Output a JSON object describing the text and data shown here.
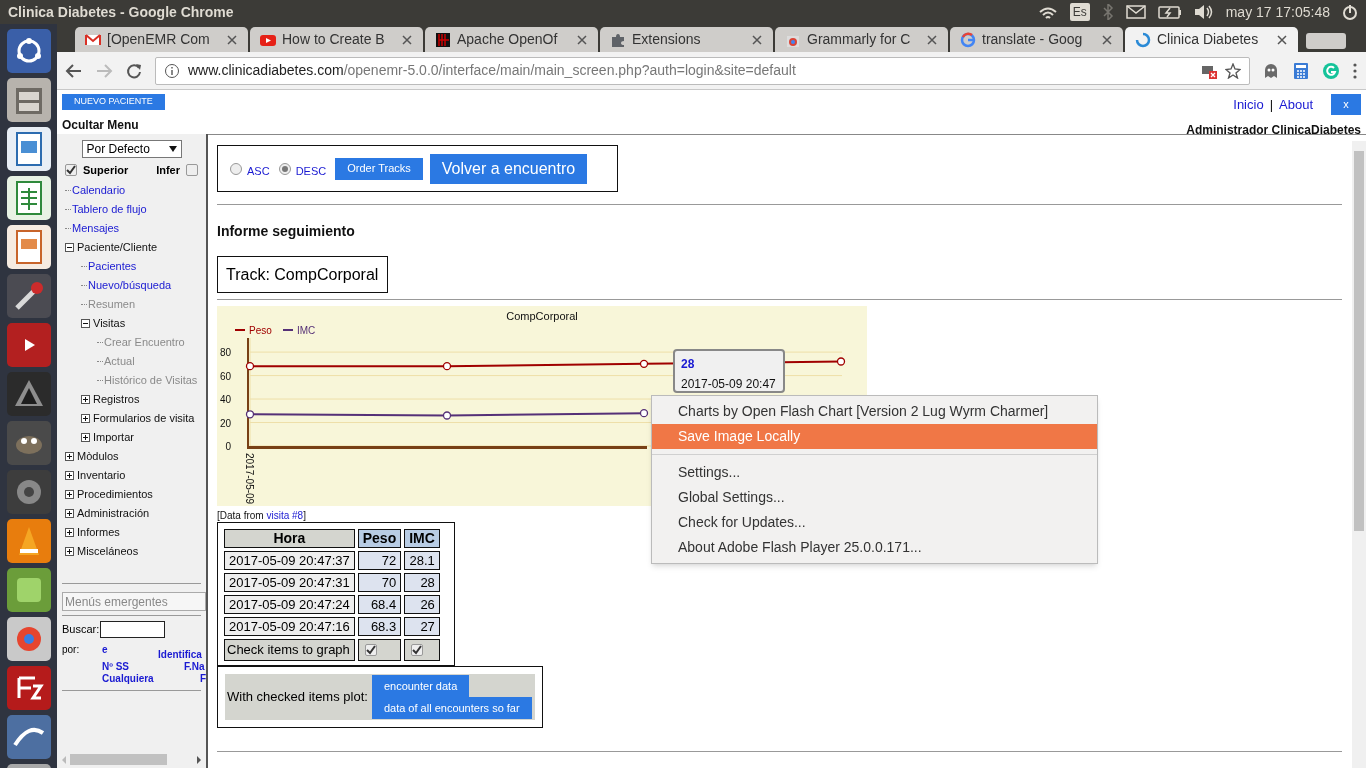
{
  "top_panel": {
    "title": "Clinica Diabetes - Google Chrome",
    "keyboard_layout": "Es",
    "clock": "may 17 17:05:48"
  },
  "browser": {
    "tabs": [
      {
        "title": "[OpenEMR Com",
        "kind": "gmail",
        "selected": false
      },
      {
        "title": "How to Create B",
        "kind": "youtube",
        "selected": false
      },
      {
        "title": "Apache OpenOf",
        "kind": "openoffice",
        "selected": false
      },
      {
        "title": "Extensions",
        "kind": "puzzle",
        "selected": false
      },
      {
        "title": "Grammarly for C",
        "kind": "store",
        "selected": false
      },
      {
        "title": "translate - Goog",
        "kind": "google",
        "selected": false
      },
      {
        "title": "Clinica Diabetes",
        "kind": "loading",
        "selected": true
      }
    ],
    "address": {
      "host": "www.clinicadiabetes.com",
      "path": "/openemr-5.0.0/interface/main/main_screen.php?auth=login&site=default"
    }
  },
  "page": {
    "new_patient_button": "NUEVO PACIENTE",
    "hide_menu": "Ocultar Menu",
    "nav_links": [
      "Inicio",
      "About"
    ],
    "nav_separator": "|",
    "close_button": "x",
    "user": "Administrador ClinicaDiabetes"
  },
  "sidebar": {
    "view_select": "Por Defecto",
    "checkboxes": [
      {
        "label": "Superior",
        "checked": true
      },
      {
        "label": "Infer",
        "checked": false
      }
    ],
    "menu": [
      {
        "label": "Calendario",
        "kind": "link",
        "disabled": false
      },
      {
        "label": "Tablero de flujo",
        "kind": "link",
        "disabled": false
      },
      {
        "label": "Mensajes",
        "kind": "link",
        "disabled": false
      },
      {
        "label": "Paciente/Cliente",
        "kind": "folder",
        "expanded": true,
        "children": [
          {
            "label": "Pacientes",
            "kind": "link",
            "disabled": false
          },
          {
            "label": "Nuevo/búsqueda",
            "kind": "link",
            "disabled": false
          },
          {
            "label": "Resumen",
            "kind": "link",
            "disabled": true
          },
          {
            "label": "Visitas",
            "kind": "folder",
            "expanded": true,
            "children": [
              {
                "label": "Crear Encuentro",
                "kind": "link",
                "disabled": true
              },
              {
                "label": "Actual",
                "kind": "link",
                "disabled": true
              },
              {
                "label": "Histórico de Visitas",
                "kind": "link",
                "disabled": true
              }
            ]
          },
          {
            "label": "Registros",
            "kind": "folder",
            "expanded": false
          },
          {
            "label": "Formularios de visita",
            "kind": "folder",
            "expanded": false
          },
          {
            "label": "Importar",
            "kind": "folder",
            "expanded": false
          }
        ]
      },
      {
        "label": "Mòdulos",
        "kind": "folder",
        "expanded": false
      },
      {
        "label": "Inventario",
        "kind": "folder",
        "expanded": false
      },
      {
        "label": "Procedimientos",
        "kind": "folder",
        "expanded": false
      },
      {
        "label": "Administración",
        "kind": "folder",
        "expanded": false
      },
      {
        "label": "Informes",
        "kind": "folder",
        "expanded": false
      },
      {
        "label": "Misceláneos",
        "kind": "folder",
        "expanded": false
      }
    ],
    "popup_select": "Menús emergentes",
    "search_label": "Buscar:",
    "search_by_label": "por:",
    "search_options": [
      "e",
      "Identifica",
      "Nº SS",
      "F.Na",
      "Cualquiera",
      "F"
    ]
  },
  "main": {
    "sort": [
      {
        "label": "ASC",
        "selected": false
      },
      {
        "label": "DESC",
        "selected": true
      }
    ],
    "order_button": "Order Tracks",
    "back_button": "Volver a encuentro",
    "heading": "Informe seguimiento",
    "track": "Track: CompCorporal",
    "chart_data": {
      "type": "line",
      "title": "CompCorporal",
      "annotations": [
        "2017-05-09"
      ],
      "ylim": [
        0,
        92
      ],
      "grid": true,
      "legend": "top-left",
      "yticks": [
        {
          "value": 0,
          "label": "0"
        },
        {
          "value": 20,
          "label": "20"
        },
        {
          "value": 40,
          "label": "40"
        },
        {
          "value": 60,
          "label": "60"
        },
        {
          "value": 80,
          "label": "80"
        }
      ],
      "series": [
        {
          "name": "Peso",
          "color": "#a00000",
          "marker": "circle",
          "values": [
            68,
            68,
            70,
            72
          ]
        },
        {
          "name": "IMC",
          "color": "#553077",
          "marker": "circle",
          "values": [
            27,
            26,
            28,
            null
          ]
        }
      ]
    },
    "tooltip": {
      "value": "28",
      "time": "2017-05-09 20:47"
    },
    "data_source": {
      "prefix": "[Data from",
      "link": "visita #8",
      "suffix": "]"
    },
    "table": {
      "columns": [
        "Hora",
        "Peso",
        "IMC"
      ],
      "rows": [
        [
          "2017-05-09 20:47:37",
          "72",
          "28.1"
        ],
        [
          "2017-05-09 20:47:31",
          "70",
          "28"
        ],
        [
          "2017-05-09 20:47:24",
          "68.4",
          "26"
        ],
        [
          "2017-05-09 20:47:16",
          "68.3",
          "27"
        ]
      ],
      "check_label": "Check items to graph",
      "checks": [
        {
          "checked": true
        },
        {
          "checked": true
        }
      ]
    },
    "plot_label": "With checked items plot:",
    "plot_buttons": [
      "encounter data",
      "data of all encounters so far"
    ]
  },
  "context_menu": {
    "sections": [
      [
        {
          "label": "Charts by Open Flash Chart [Version 2 Lug Wyrm Charmer]",
          "selected": false
        },
        {
          "label": "Save Image Locally",
          "selected": true
        }
      ],
      [
        {
          "label": "Settings...",
          "selected": false
        },
        {
          "label": "Global Settings...",
          "selected": false
        },
        {
          "label": "Check for Updates...",
          "selected": false
        },
        {
          "label": "About Adobe Flash Player 25.0.0.171...",
          "selected": false
        }
      ]
    ]
  }
}
